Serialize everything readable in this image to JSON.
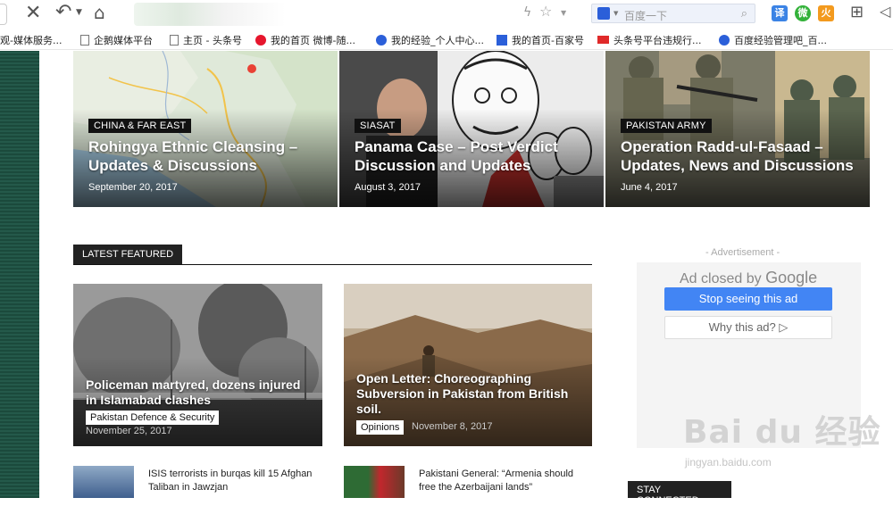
{
  "browser": {
    "search_placeholder": "百度一下",
    "bookmarks": [
      {
        "label": "观-媒体服务..."
      },
      {
        "label": "企鹅媒体平台"
      },
      {
        "label": "主页 - 头条号"
      },
      {
        "label": "我的首页 微博-随..."
      },
      {
        "label": "我的经验_个人中心..."
      },
      {
        "label": "我的首页-百家号"
      },
      {
        "label": "头条号平台违规行..."
      },
      {
        "label": "百度经验管理吧_百..."
      }
    ],
    "extensions": [
      "译",
      "微",
      "火"
    ]
  },
  "slider": [
    {
      "category": "China & Far East",
      "title": "Rohingya Ethnic Cleansing – Updates & Discussions",
      "date": "September 20, 2017"
    },
    {
      "category": "SIASAT",
      "title": "Panama Case – Post Verdict Discussion and Updates",
      "date": "August 3, 2017"
    },
    {
      "category": "Pakistan Army",
      "title": "Operation Radd-ul-Fasaad – Updates, News and Discussions",
      "date": "June 4, 2017"
    }
  ],
  "latest_featured": {
    "heading": "Latest Featured",
    "cards": [
      {
        "title": "Policeman martyred, dozens injured in Islamabad clashes",
        "tag": "Pakistan Defence & Security",
        "date": "November 25, 2017"
      },
      {
        "title": "Open Letter: Choreographing Subversion in Pakistan from British soil.",
        "tag": "Opinions",
        "date": "November 8, 2017"
      }
    ],
    "mini_items": [
      {
        "title": "ISIS terrorists in burqas kill 15 Afghan Taliban in Jawzjan"
      },
      {
        "title": "Pakistani General: “Armenia should free the Azerbaijani lands”"
      }
    ]
  },
  "ad": {
    "label": "- Advertisement -",
    "closed_prefix": "Ad closed by ",
    "closed_brand": "Google",
    "stop_button": "Stop seeing this ad",
    "why_button": "Why this ad? ▷"
  },
  "stay_connected": "Stay Connected",
  "watermark": {
    "main": "Bai du 经验",
    "sub": "jingyan.baidu.com"
  }
}
